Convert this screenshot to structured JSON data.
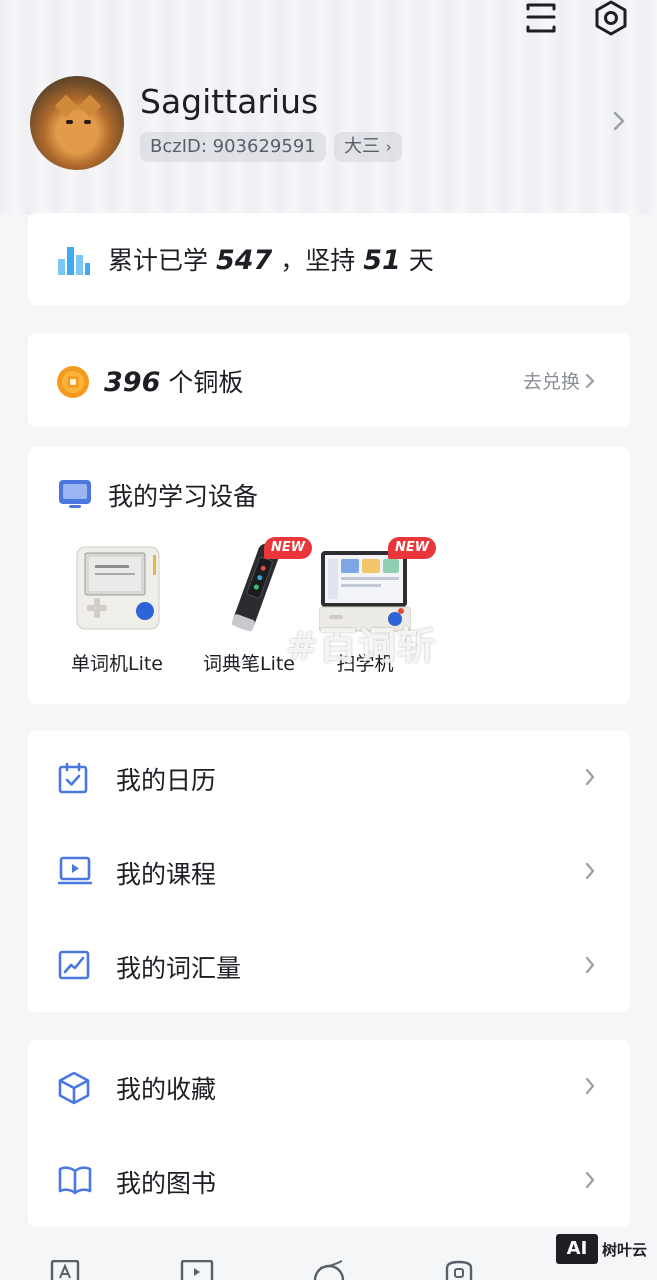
{
  "header": {
    "username": "Sagittarius",
    "bcz_id": "BczID: 903629591",
    "grade": "大三"
  },
  "stats": {
    "prefix": "累计已学",
    "learned": "547",
    "sep": "，坚持",
    "days": "51",
    "suffix": "天"
  },
  "coins": {
    "count": "396",
    "label": "个铜板",
    "redeem": "去兑换"
  },
  "devices": {
    "title": "我的学习设备",
    "items": [
      {
        "name": "单词机Lite",
        "badge": ""
      },
      {
        "name": "词典笔Lite",
        "badge": "NEW"
      },
      {
        "name": "扫学机",
        "badge": "NEW"
      }
    ],
    "watermark": "#百词斩"
  },
  "menu_group_1": [
    {
      "label": "我的日历",
      "icon": "calendar-icon"
    },
    {
      "label": "我的课程",
      "icon": "course-icon"
    },
    {
      "label": "我的词汇量",
      "icon": "vocabulary-chart-icon"
    }
  ],
  "menu_group_2": [
    {
      "label": "我的收藏",
      "icon": "cube-icon"
    },
    {
      "label": "我的图书",
      "icon": "book-icon"
    }
  ],
  "corner_logo": {
    "box": "AI",
    "text": "树叶云"
  },
  "colors": {
    "accent_blue": "#4a78e0",
    "coin_orange": "#f39a1f",
    "badge_red": "#e8363a",
    "chart_cyan": "#43a9ee"
  }
}
